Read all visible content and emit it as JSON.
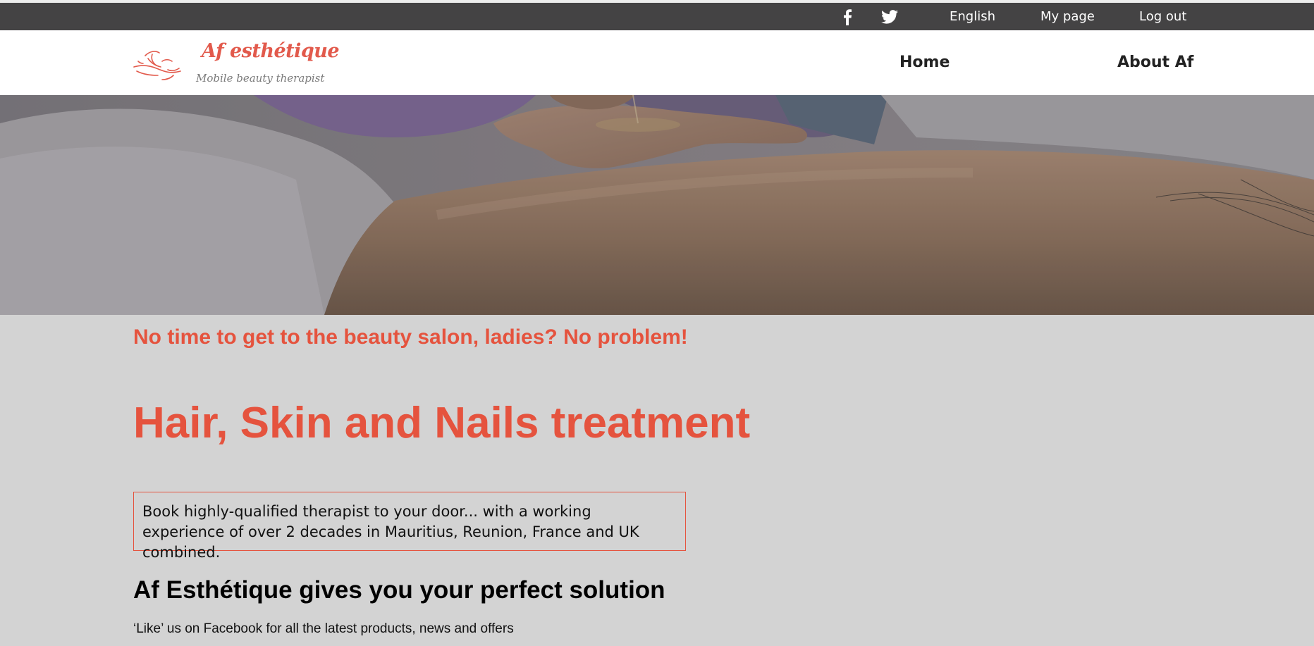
{
  "topbar": {
    "social": [
      {
        "icon": "facebook-icon"
      },
      {
        "icon": "twitter-icon"
      }
    ],
    "language": "English",
    "my_page": "My page",
    "log_out": "Log out"
  },
  "header": {
    "logo": {
      "brand": "Af esthétique",
      "tagline": "Mobile beauty therapist"
    },
    "nav": {
      "home": "Home",
      "about": "About Af"
    }
  },
  "hero": {
    "image": "massage-oil-back-photo"
  },
  "main": {
    "subheading": "No time to get to the beauty salon, ladies? No problem!",
    "headline": "Hair, Skin and Nails treatment",
    "info_box": "Book highly-qualified therapist to your door... with a working experience of over 2 decades in Mauritius, Reunion, France and UK combined.",
    "section_title": "Af Esthétique gives you your perfect solution",
    "like_text": "‘Like’ us on Facebook for all the latest products, news and offers"
  },
  "colors": {
    "accent": "#e5533e",
    "topbar_bg": "#444344",
    "page_bg": "#d3d3d3"
  }
}
